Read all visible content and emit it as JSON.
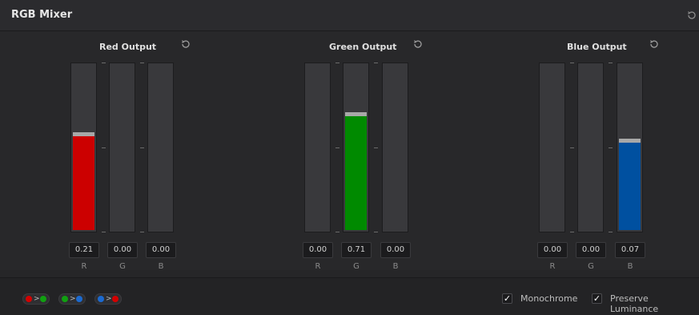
{
  "panel_title": "RGB Mixer",
  "groups": [
    {
      "title": "Red Output",
      "values": [
        "0.21",
        "0.00",
        "0.00"
      ],
      "levels": [
        0.57,
        0,
        0
      ]
    },
    {
      "title": "Green Output",
      "values": [
        "0.00",
        "0.71",
        "0.00"
      ],
      "levels": [
        0,
        0.69,
        0
      ]
    },
    {
      "title": "Blue Output",
      "values": [
        "0.00",
        "0.00",
        "0.07"
      ],
      "levels": [
        0,
        0,
        0.53
      ]
    }
  ],
  "channel_labels": [
    "R",
    "G",
    "B"
  ],
  "footer": {
    "swap_arrow": ">",
    "monochrome_label": "Monochrome",
    "preserve_label": "Preserve Luminance",
    "check_mark": "✓"
  },
  "colors": {
    "red": "#cc0000",
    "green": "#008a00",
    "blue": "#0050a0",
    "handle": "#a8a8a8"
  }
}
